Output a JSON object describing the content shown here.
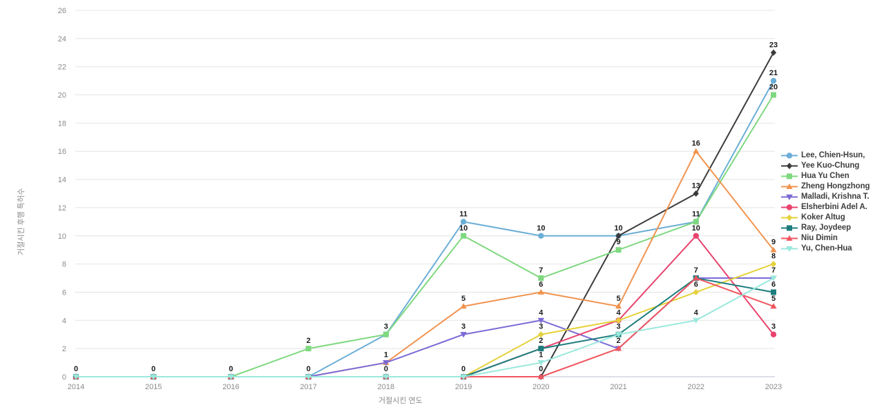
{
  "chart_data": {
    "type": "line",
    "title": "",
    "xlabel": "거절시킨 연도",
    "ylabel": "거절시킨 후행 특허수",
    "categories": [
      "2014",
      "2015",
      "2016",
      "2017",
      "2018",
      "2019",
      "2020",
      "2021",
      "2022",
      "2023"
    ],
    "ylim": [
      0,
      26
    ],
    "yticks": [
      0,
      2,
      4,
      6,
      8,
      10,
      12,
      14,
      16,
      18,
      20,
      22,
      24,
      26
    ],
    "grid": true,
    "legend_position": "right",
    "value_labels": true,
    "series": [
      {
        "name": "Lee, Chien-Hsun,",
        "color": "#6BAED6",
        "marker": "circle",
        "values": [
          0,
          0,
          0,
          0,
          3,
          11,
          10,
          10,
          11,
          21
        ]
      },
      {
        "name": "Yee Kuo-Chung",
        "color": "#3B3B3B",
        "marker": "diamond",
        "values": [
          0,
          0,
          0,
          0,
          0,
          0,
          0,
          10,
          13,
          23
        ]
      },
      {
        "name": "Hua Yu Chen",
        "color": "#7FD87F",
        "marker": "square",
        "values": [
          0,
          0,
          0,
          2,
          3,
          10,
          7,
          9,
          11,
          20
        ]
      },
      {
        "name": "Zheng Hongzhong",
        "color": "#F0934E",
        "marker": "triangle",
        "values": [
          0,
          0,
          0,
          0,
          1,
          5,
          6,
          5,
          16,
          9
        ]
      },
      {
        "name": "Malladi, Krishna T.",
        "color": "#7B6AD6",
        "marker": "star",
        "values": [
          0,
          0,
          0,
          0,
          1,
          3,
          4,
          2,
          7,
          7
        ]
      },
      {
        "name": "Elsherbini Adel A.",
        "color": "#E8436E",
        "marker": "circle",
        "values": [
          0,
          0,
          0,
          0,
          0,
          0,
          2,
          4,
          10,
          3
        ]
      },
      {
        "name": "Koker Altug",
        "color": "#E5D13A",
        "marker": "diamond",
        "values": [
          0,
          0,
          0,
          0,
          0,
          0,
          3,
          4,
          6,
          8
        ]
      },
      {
        "name": "Ray, Joydeep",
        "color": "#1C7D7D",
        "marker": "square",
        "values": [
          0,
          0,
          0,
          0,
          0,
          0,
          2,
          3,
          7,
          6
        ]
      },
      {
        "name": "Niu Dimin",
        "color": "#F0555F",
        "marker": "triangle",
        "values": [
          0,
          0,
          0,
          0,
          0,
          0,
          0,
          2,
          7,
          5
        ]
      },
      {
        "name": "Yu, Chen-Hua",
        "color": "#9AE8DC",
        "marker": "star",
        "values": [
          0,
          0,
          0,
          0,
          0,
          0,
          1,
          3,
          4,
          7
        ]
      }
    ],
    "zero_labels": {
      "2014": "0",
      "2015": "0",
      "2016": "0",
      "2017": "0",
      "2018": "0",
      "2019": "0",
      "2020": "0"
    }
  },
  "axis": {
    "ytick_color": "#8a8a8a",
    "xtick_color": "#8a8a8a",
    "grid_color": "#e4e4e4",
    "baseline_color": "#c8cdd6"
  },
  "legend": {
    "items": [
      {
        "label": "Lee, Chien-Hsun,"
      },
      {
        "label": "Yee Kuo-Chung"
      },
      {
        "label": "Hua Yu Chen"
      },
      {
        "label": "Zheng Hongzhong"
      },
      {
        "label": "Malladi, Krishna T."
      },
      {
        "label": "Elsherbini Adel A."
      },
      {
        "label": "Koker Altug"
      },
      {
        "label": "Ray, Joydeep"
      },
      {
        "label": "Niu Dimin"
      },
      {
        "label": "Yu, Chen-Hua"
      }
    ]
  }
}
